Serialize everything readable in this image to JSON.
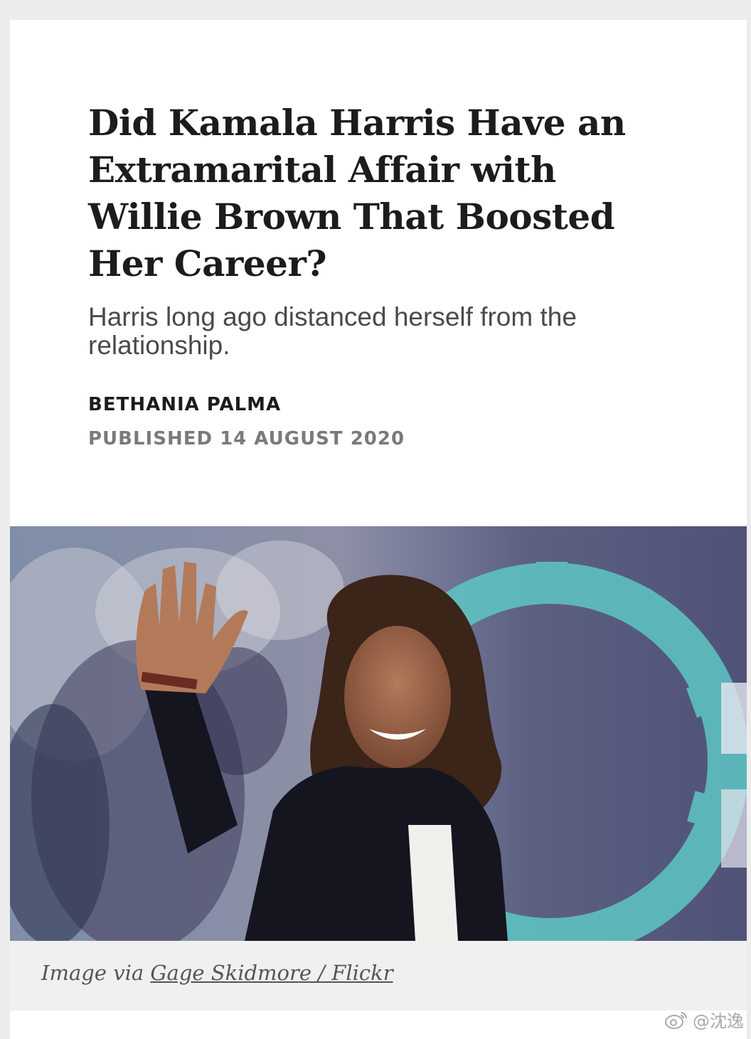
{
  "article": {
    "headline": "Did Kamala Harris Have an Extramarital Affair with Willie Brown That Boosted Her Career?",
    "subheadline": "Harris long ago distanced herself from the relationship.",
    "author": "BETHANIA PALMA",
    "published_label": "PUBLISHED",
    "published_date": "14 AUGUST 2020"
  },
  "image": {
    "caption_prefix": "Image via",
    "caption_link": "Gage Skidmore / Flickr"
  },
  "watermark": {
    "handle": "@沈逸",
    "icon": "weibo-logo-icon"
  },
  "colors": {
    "page_bg": "#ececec",
    "card_bg": "#ffffff",
    "headline": "#1c1c1c",
    "muted": "#7a7a7a",
    "caption_bg": "#f0f0f0"
  }
}
